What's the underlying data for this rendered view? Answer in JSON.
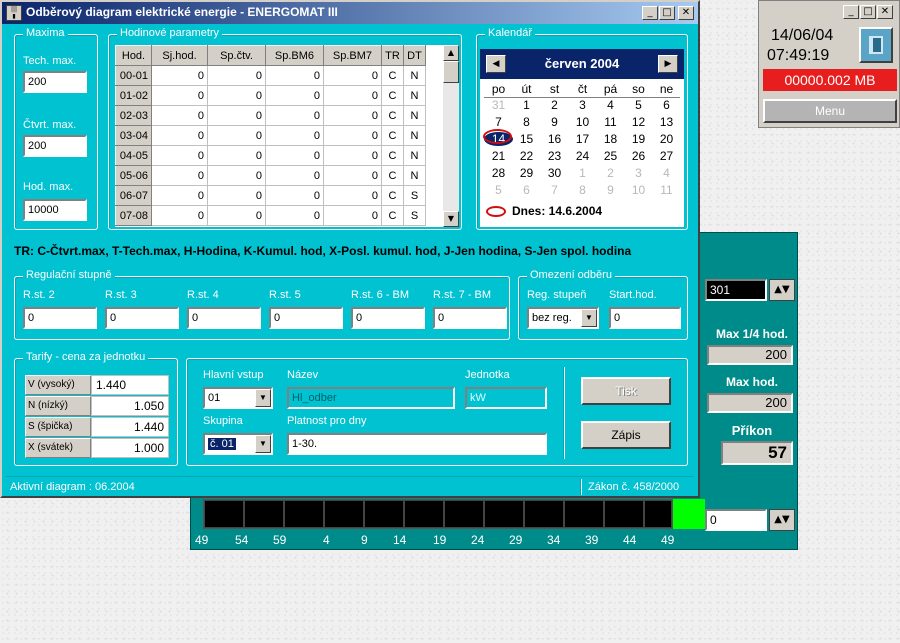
{
  "desktop_window": {
    "date": "14/06/04",
    "time": "07:49:19",
    "memory": "00000.002 MB",
    "menu_label": "Menu"
  },
  "back_window": {
    "spin_value": "301",
    "max_quarter_label": "Max 1/4 hod.",
    "max_quarter_value": "200",
    "max_hour_label": "Max hod.",
    "max_hour_value": "200",
    "input_label": "Příkon",
    "input_value": "57",
    "bottom_spin_value": "0",
    "axis_labels": [
      "49",
      "54",
      "59",
      "4",
      "9",
      "14",
      "19",
      "24",
      "29",
      "34",
      "39",
      "44",
      "49"
    ]
  },
  "main_window": {
    "title": "Odběrový diagram elektrické energie - ENERGOMAT III",
    "maxima": {
      "title": "Maxima",
      "tech_label": "Tech. max.",
      "tech_value": "200",
      "ctvrt_label": "Čtvrt. max.",
      "ctvrt_value": "200",
      "hod_label": "Hod. max.",
      "hod_value": "10000"
    },
    "hourly": {
      "title": "Hodinové parametry",
      "columns": [
        "Hod.",
        "Sj.hod.",
        "Sp.čtv.",
        "Sp.BM6",
        "Sp.BM7",
        "TR",
        "DT"
      ],
      "rows": [
        [
          "00-01",
          "0",
          "0",
          "0",
          "0",
          "C",
          "N"
        ],
        [
          "01-02",
          "0",
          "0",
          "0",
          "0",
          "C",
          "N"
        ],
        [
          "02-03",
          "0",
          "0",
          "0",
          "0",
          "C",
          "N"
        ],
        [
          "03-04",
          "0",
          "0",
          "0",
          "0",
          "C",
          "N"
        ],
        [
          "04-05",
          "0",
          "0",
          "0",
          "0",
          "C",
          "N"
        ],
        [
          "05-06",
          "0",
          "0",
          "0",
          "0",
          "C",
          "N"
        ],
        [
          "06-07",
          "0",
          "0",
          "0",
          "0",
          "C",
          "S"
        ],
        [
          "07-08",
          "0",
          "0",
          "0",
          "0",
          "C",
          "S"
        ]
      ]
    },
    "calendar": {
      "title": "Kalendář",
      "month": "červen 2004",
      "weekdays": [
        "po",
        "út",
        "st",
        "čt",
        "pá",
        "so",
        "ne"
      ],
      "weeks": [
        [
          "31",
          "1",
          "2",
          "3",
          "4",
          "5",
          "6"
        ],
        [
          "7",
          "8",
          "9",
          "10",
          "11",
          "12",
          "13"
        ],
        [
          "14",
          "15",
          "16",
          "17",
          "18",
          "19",
          "20"
        ],
        [
          "21",
          "22",
          "23",
          "24",
          "25",
          "26",
          "27"
        ],
        [
          "28",
          "29",
          "30",
          "1",
          "2",
          "3",
          "4"
        ],
        [
          "5",
          "6",
          "7",
          "8",
          "9",
          "10",
          "11"
        ]
      ],
      "today_label": "Dnes: 14.6.2004"
    },
    "legend_text": "TR: C-Čtvrt.max, T-Tech.max, H-Hodina, K-Kumul. hod, X-Posl. kumul. hod, J-Jen hodina, S-Jen spol. hodina",
    "regulation": {
      "title": "Regulační stupně",
      "labels": [
        "R.st. 2",
        "R.st. 3",
        "R.st. 4",
        "R.st. 5",
        "R.st. 6 - BM",
        "R.st. 7 - BM"
      ],
      "values": [
        "0",
        "0",
        "0",
        "0",
        "0",
        "0"
      ]
    },
    "limit": {
      "title": "Omezení odběru",
      "reg_label": "Reg. stupeň",
      "reg_value": "bez reg.",
      "start_label": "Start.hod.",
      "start_value": "0"
    },
    "tariffs": {
      "title": "Tarify - cena za jednotku",
      "rows": [
        {
          "name": "V (vysoký)",
          "value": "1.440"
        },
        {
          "name": "N (nízký)",
          "value": "1.050"
        },
        {
          "name": "S (špička)",
          "value": "1.440"
        },
        {
          "name": "X (svátek)",
          "value": "1.000"
        }
      ]
    },
    "input": {
      "main_label": "Hlavní vstup",
      "main_value": "01",
      "name_label": "Název",
      "name_value": "Hl_odber",
      "unit_label": "Jednotka",
      "unit_value": "kW",
      "group_label": "Skupina",
      "group_value": "č. 01",
      "validity_label": "Platnost pro dny",
      "validity_value": "1-30.",
      "print_label": "Tisk",
      "save_label": "Zápis"
    },
    "status_left": "Aktivní diagram : 06.2004",
    "status_right": "Zákon č. 458/2000"
  }
}
